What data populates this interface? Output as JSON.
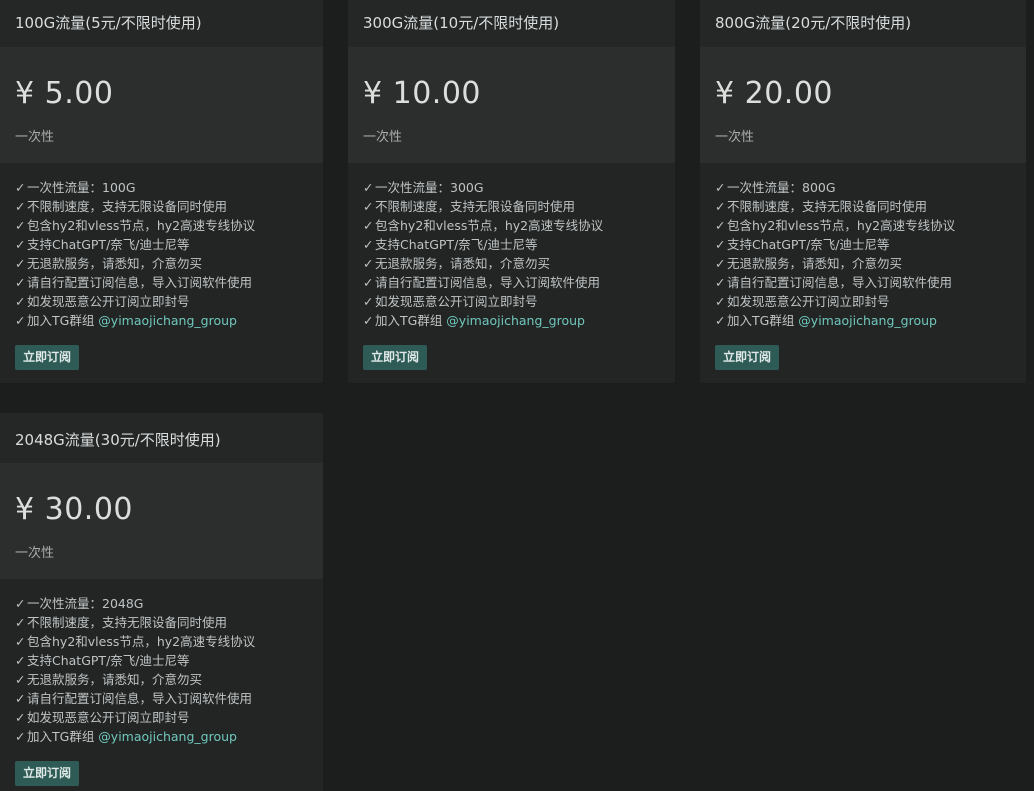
{
  "plans": [
    {
      "title": "100G流量(5元/不限时使用)",
      "price": "¥ 5.00",
      "period": "一次性",
      "features": [
        "一次性流量：100G",
        "不限制速度，支持无限设备同时使用",
        "包含hy2和vless节点，hy2高速专线协议",
        "支持ChatGPT/奈飞/迪士尼等",
        "无退款服务，请悉知，介意勿买",
        "请自行配置订阅信息，导入订阅软件使用",
        "如发现恶意公开订阅立即封号"
      ],
      "tg_prefix": "加入TG群组 ",
      "tg_handle": "@yimaojichang_group",
      "button_label": "立即订阅"
    },
    {
      "title": "300G流量(10元/不限时使用)",
      "price": "¥ 10.00",
      "period": "一次性",
      "features": [
        "一次性流量：300G",
        "不限制速度，支持无限设备同时使用",
        "包含hy2和vless节点，hy2高速专线协议",
        "支持ChatGPT/奈飞/迪士尼等",
        "无退款服务，请悉知，介意勿买",
        "请自行配置订阅信息，导入订阅软件使用",
        "如发现恶意公开订阅立即封号"
      ],
      "tg_prefix": "加入TG群组 ",
      "tg_handle": "@yimaojichang_group",
      "button_label": "立即订阅"
    },
    {
      "title": "800G流量(20元/不限时使用)",
      "price": "¥ 20.00",
      "period": "一次性",
      "features": [
        "一次性流量：800G",
        "不限制速度，支持无限设备同时使用",
        "包含hy2和vless节点，hy2高速专线协议",
        "支持ChatGPT/奈飞/迪士尼等",
        "无退款服务，请悉知，介意勿买",
        "请自行配置订阅信息，导入订阅软件使用",
        "如发现恶意公开订阅立即封号"
      ],
      "tg_prefix": "加入TG群组 ",
      "tg_handle": "@yimaojichang_group",
      "button_label": "立即订阅"
    },
    {
      "title": "2048G流量(30元/不限时使用)",
      "price": "¥ 30.00",
      "period": "一次性",
      "features": [
        "一次性流量：2048G",
        "不限制速度，支持无限设备同时使用",
        "包含hy2和vless节点，hy2高速专线协议",
        "支持ChatGPT/奈飞/迪士尼等",
        "无退款服务，请悉知，介意勿买",
        "请自行配置订阅信息，导入订阅软件使用",
        "如发现恶意公开订阅立即封号"
      ],
      "tg_prefix": "加入TG群组 ",
      "tg_handle": "@yimaojichang_group",
      "button_label": "立即订阅"
    }
  ],
  "check_glyph": "✓",
  "colors": {
    "page_background": "#1c1e1e",
    "card_background": "#232525",
    "price_background": "#2c2e2e",
    "link": "#6fc7bb",
    "button_background": "#2f5b57"
  }
}
